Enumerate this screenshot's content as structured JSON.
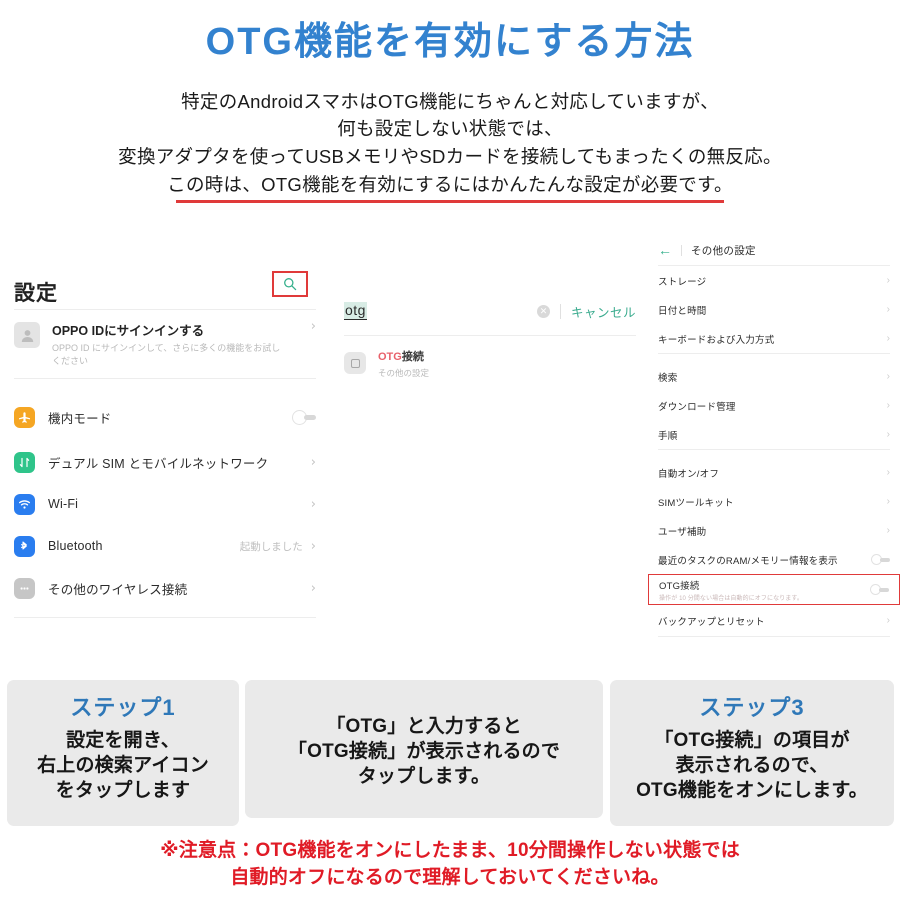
{
  "header": {
    "title": "OTG機能を有効にする方法",
    "intro_lines": [
      "特定のAndroidスマホはOTG機能にちゃんと対応していますが、",
      "何も設定しない状態では、",
      "変換アダプタを使ってUSBメモリやSDカードを接続してもまったくの無反応。",
      "この時は、OTG機能を有効にするにはかんたんな設定が必要です。"
    ],
    "title_color": "#3382cf",
    "underline_color": "#e03a3a"
  },
  "left_panel": {
    "title": "設定",
    "search_icon": "search-icon",
    "search_icon_color": "#35b08c",
    "highlight_color": "#e03a3a",
    "account": {
      "title": "OPPO IDにサインインする",
      "subtitle": "OPPO ID にサインインして、さらに多くの機能をお試しください",
      "chevron": "›"
    },
    "rows": [
      {
        "label": "機内モード",
        "icon": "airplane-icon",
        "icon_color": "#f5a623",
        "control": "toggle",
        "status": ""
      },
      {
        "label": "デュアル SIM とモバイルネットワーク",
        "icon": "sim-card-icon",
        "icon_color": "#2fc48a",
        "control": "chevron",
        "status": ""
      },
      {
        "label": "Wi-Fi",
        "icon": "wifi-icon",
        "icon_color": "#2a7def",
        "control": "chevron",
        "status": ""
      },
      {
        "label": "Bluetooth",
        "icon": "bluetooth-icon",
        "icon_color": "#2a7def",
        "control": "chevron",
        "status": "起動しました"
      },
      {
        "label": "その他のワイヤレス接続",
        "icon": "more-dots-icon",
        "icon_color": "#c6c6c6",
        "control": "chevron",
        "status": ""
      }
    ]
  },
  "mid_panel": {
    "query": "otg",
    "clear_icon": "clear-circle-icon",
    "cancel_label": "キャンセル",
    "cancel_color": "#3aab8e",
    "result": {
      "match": "OTG",
      "rest": "接続",
      "subtitle": "その他の設定",
      "icon": "otg-connection-icon",
      "match_color": "#e8616b"
    }
  },
  "right_panel": {
    "back_icon": "back-arrow-icon",
    "title": "その他の設定",
    "group1": [
      {
        "label": "ストレージ",
        "control": "chevron"
      },
      {
        "label": "日付と時間",
        "control": "chevron"
      },
      {
        "label": "キーボードおよび入力方式",
        "control": "chevron"
      }
    ],
    "group2": [
      {
        "label": "検索",
        "control": "chevron"
      },
      {
        "label": "ダウンロード管理",
        "control": "chevron"
      },
      {
        "label": "手順",
        "control": "chevron"
      }
    ],
    "group3": [
      {
        "label": "自動オン/オフ",
        "control": "chevron"
      },
      {
        "label": "SIMツールキット",
        "control": "chevron"
      },
      {
        "label": "ユーザ補助",
        "control": "chevron"
      },
      {
        "label": "最近のタスクのRAM/メモリー情報を表示",
        "control": "toggle"
      }
    ],
    "otg_row": {
      "label": "OTG接続",
      "subtitle": "操作が 10 分間ない場合は自動的にオフになります。",
      "control": "toggle",
      "highlight_color": "#e03a3a"
    },
    "group4": [
      {
        "label": "バックアップとリセット",
        "control": "chevron"
      }
    ]
  },
  "steps": {
    "step1": {
      "label": "ステップ1",
      "body_lines": [
        "設定を開き、",
        "右上の検索アイコン",
        "をタップします"
      ]
    },
    "step2": {
      "label": "",
      "body_lines": [
        "「OTG」と入力すると",
        "「OTG接続」が表示されるので",
        "タップします。"
      ]
    },
    "step3": {
      "label": "ステップ3",
      "body_lines": [
        "「OTG接続」の項目が",
        "表示されるので、",
        "OTG機能をオンにします。"
      ]
    },
    "label_color": "#2f78b8"
  },
  "warning": {
    "lines": [
      "※注意点：OTG機能をオンにしたまま、10分間操作しない状態では",
      "自動的オフになるので理解しておいてくださいね。"
    ],
    "color": "#e01b26"
  }
}
